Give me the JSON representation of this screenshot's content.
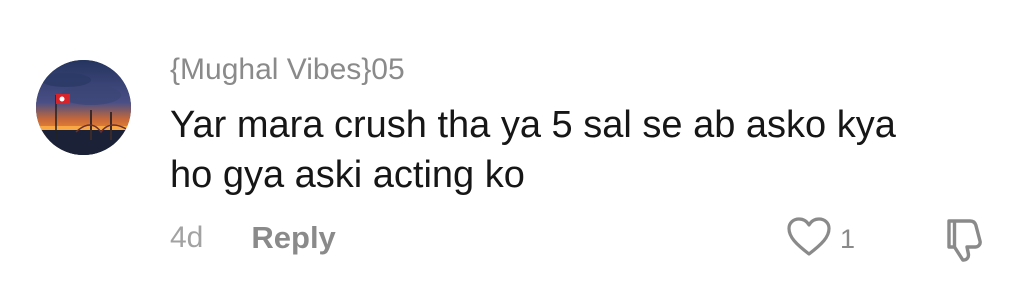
{
  "comment": {
    "avatar_icon": "profile-avatar-sunset-flag",
    "username": "{Mughal Vibes}05",
    "text": "Yar mara crush tha ya 5 sal se ab asko kya\nho gya aski acting ko",
    "timestamp": "4d",
    "reply_label": "Reply",
    "like_icon": "heart-outline-icon",
    "like_count": "1",
    "dislike_icon": "thumbs-down-icon"
  },
  "colors": {
    "text_primary": "#161616",
    "text_secondary": "#8a8a8a",
    "icon_color": "#8a8a8a"
  }
}
